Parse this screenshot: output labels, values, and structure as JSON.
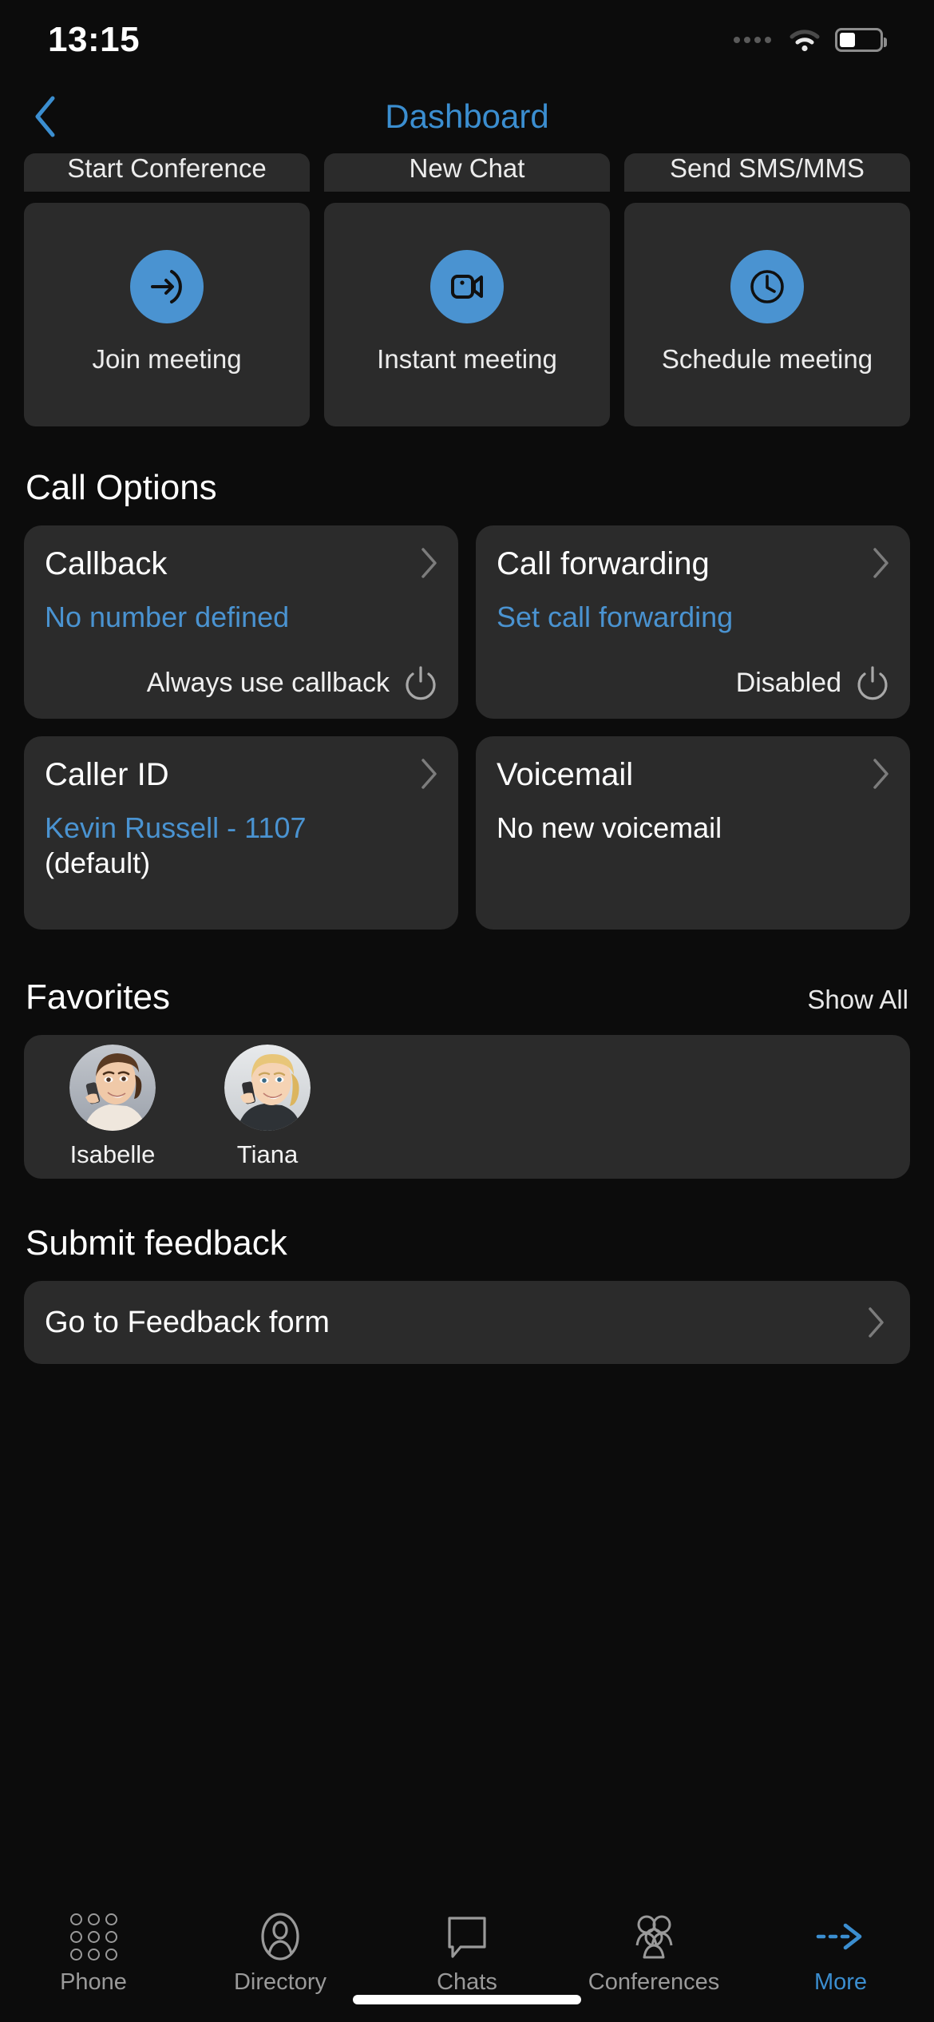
{
  "status_bar": {
    "time": "13:15",
    "signal_icon": "signal-dots-icon",
    "wifi_icon": "wifi-icon",
    "battery_icon": "battery-icon"
  },
  "nav": {
    "back_icon": "chevron-left-icon",
    "title": "Dashboard"
  },
  "quick_actions_row1": [
    {
      "label": "Start Conference"
    },
    {
      "label": "New Chat"
    },
    {
      "label": "Send SMS/MMS"
    }
  ],
  "quick_actions_row2": [
    {
      "label": "Join meeting",
      "icon": "join-meeting-arrow-icon"
    },
    {
      "label": "Instant meeting",
      "icon": "video-camera-icon"
    },
    {
      "label": "Schedule meeting",
      "icon": "clock-icon"
    }
  ],
  "call_options": {
    "heading": "Call Options",
    "cards": [
      {
        "title": "Callback",
        "value": "No number defined",
        "value_color": "#4a93d1",
        "footer_text": "Always use callback",
        "footer_icon": "power-toggle-icon",
        "chevron": "chevron-right-icon"
      },
      {
        "title": "Call forwarding",
        "value": "Set call forwarding",
        "value_color": "#4a93d1",
        "footer_text": "Disabled",
        "footer_icon": "power-toggle-icon",
        "chevron": "chevron-right-icon"
      },
      {
        "title": "Caller ID",
        "value": "Kevin Russell - 1107",
        "value_color": "#4a93d1",
        "value_secondary": "(default)",
        "chevron": "chevron-right-icon"
      },
      {
        "title": "Voicemail",
        "value": "No new voicemail",
        "value_color": "#ffffff",
        "chevron": "chevron-right-icon"
      }
    ]
  },
  "favorites": {
    "heading": "Favorites",
    "show_all": "Show All",
    "contacts": [
      {
        "name": "Isabelle",
        "avatar": "photo-woman-on-phone-brunette"
      },
      {
        "name": "Tiana",
        "avatar": "photo-woman-on-phone-blonde"
      }
    ]
  },
  "feedback": {
    "heading": "Submit feedback",
    "link_label": "Go to Feedback form",
    "chevron": "chevron-right-icon"
  },
  "tabbar": {
    "items": [
      {
        "label": "Phone",
        "icon": "keypad-icon",
        "active": false
      },
      {
        "label": "Directory",
        "icon": "person-icon",
        "active": false
      },
      {
        "label": "Chats",
        "icon": "speech-bubble-icon",
        "active": false
      },
      {
        "label": "Conferences",
        "icon": "people-group-icon",
        "active": false
      },
      {
        "label": "More",
        "icon": "dashed-arrow-right-icon",
        "active": true
      }
    ]
  },
  "colors": {
    "accent": "#3b8ed0",
    "icon_circle": "#4a93d1",
    "card_bg": "#2b2b2b",
    "page_bg": "#0c0c0c",
    "muted_text": "#9a9a9a"
  }
}
